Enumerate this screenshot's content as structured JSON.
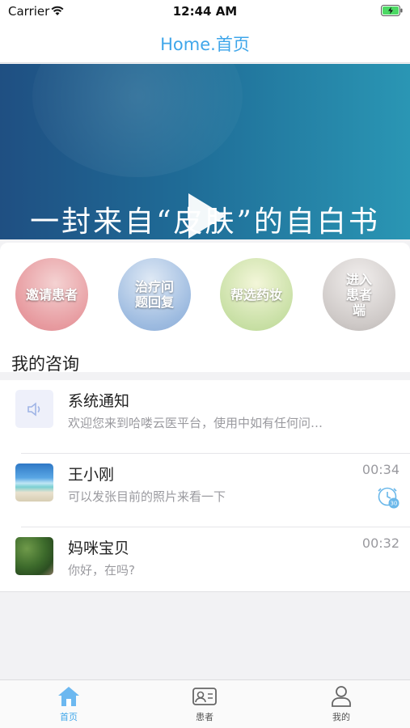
{
  "status_bar": {
    "carrier": "Carrier",
    "time": "12:44 AM"
  },
  "navbar": {
    "title": "Home.首页"
  },
  "banner": {
    "text": "一封来自“皮肤”的自白书",
    "slide_count": 5,
    "active_slide": 1
  },
  "quick_actions": [
    {
      "label": "邀请患者"
    },
    {
      "label": "治疗问题回复"
    },
    {
      "label": "帮选药妆"
    },
    {
      "label": "进入患者端"
    }
  ],
  "section": {
    "title": "我的咨询"
  },
  "consultations": [
    {
      "name": "系统通知",
      "message": "欢迎您来到哈喽云医平台，使用中如有任何问…",
      "time": "",
      "icon": "speaker-icon"
    },
    {
      "name": "王小刚",
      "message": "可以发张目前的照片来看一下",
      "time": "00:34",
      "badge": "30",
      "icon": "clock-badge-icon"
    },
    {
      "name": "妈咪宝贝",
      "message": "你好，在吗?",
      "time": "00:32"
    }
  ],
  "tabbar": {
    "items": [
      {
        "label": "首页",
        "icon": "home-icon",
        "active": true
      },
      {
        "label": "患者",
        "icon": "contact-card-icon",
        "active": false
      },
      {
        "label": "我的",
        "icon": "person-icon",
        "active": false
      }
    ]
  },
  "colors": {
    "accent": "#3fa6ea",
    "banner_start": "#1f4f82",
    "banner_end": "#2a96b4"
  }
}
